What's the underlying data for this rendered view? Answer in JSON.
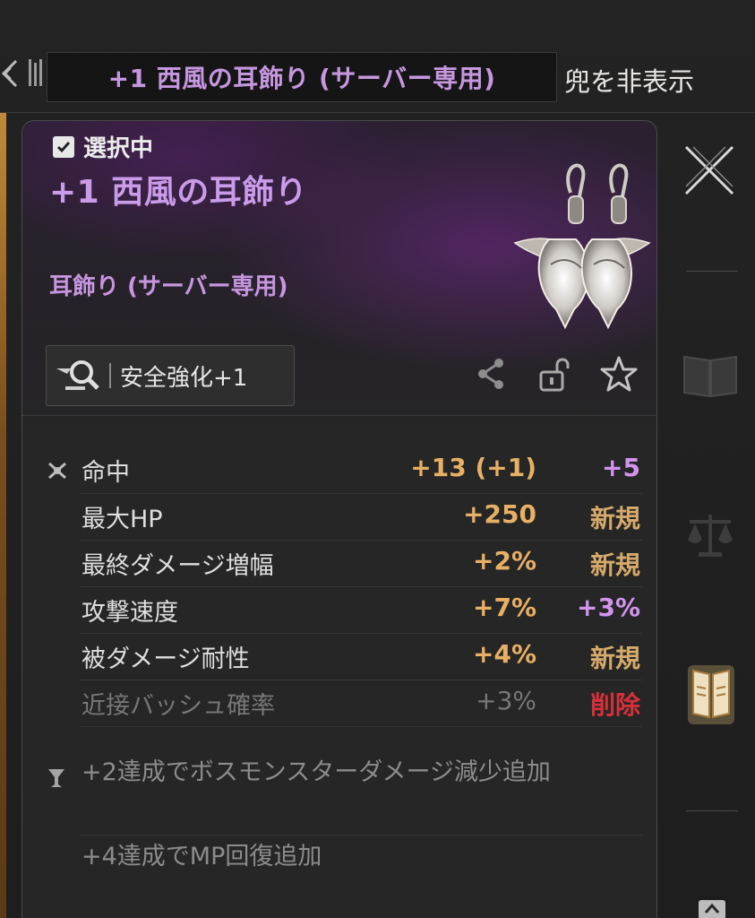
{
  "topbar": {
    "title": "+1 西風の耳飾り (サーバー専用)",
    "hide_helmet_label": "兜を非表示"
  },
  "item": {
    "selected_label": "選択中",
    "name": "+1 西風の耳飾り",
    "type": "耳飾り (サーバー専用)",
    "image_icon": "earrings-icon"
  },
  "enhance": {
    "label": "安全強化+1",
    "icon": "magnifier-icon"
  },
  "actions": {
    "share_icon": "share-icon",
    "lock_icon": "lock-icon",
    "favorite_icon": "star-icon"
  },
  "stats": [
    {
      "name": "命中",
      "value": "+13 (+1)",
      "change": "+5",
      "change_type": "increase"
    },
    {
      "name": "最大HP",
      "value": "+250",
      "change": "新規",
      "change_type": "new"
    },
    {
      "name": "最終ダメージ増幅",
      "value": "+2%",
      "change": "新規",
      "change_type": "new"
    },
    {
      "name": "攻撃速度",
      "value": "+7%",
      "change": "+3%",
      "change_type": "increase"
    },
    {
      "name": "被ダメージ耐性",
      "value": "+4%",
      "change": "新規",
      "change_type": "new"
    },
    {
      "name": "近接バッシュ確率",
      "value": "+3%",
      "change": "削除",
      "change_type": "removed"
    }
  ],
  "set_bonus": {
    "line1": "+2達成でボスモンスターダメージ減少追加",
    "line2": "+4達成でMP回復追加"
  },
  "colors": {
    "item_name": "#c99be8",
    "stat_value": "#e8b064",
    "change_increase": "#d394ee",
    "change_new": "#d5aa6a",
    "change_removed": "#d8303a"
  }
}
